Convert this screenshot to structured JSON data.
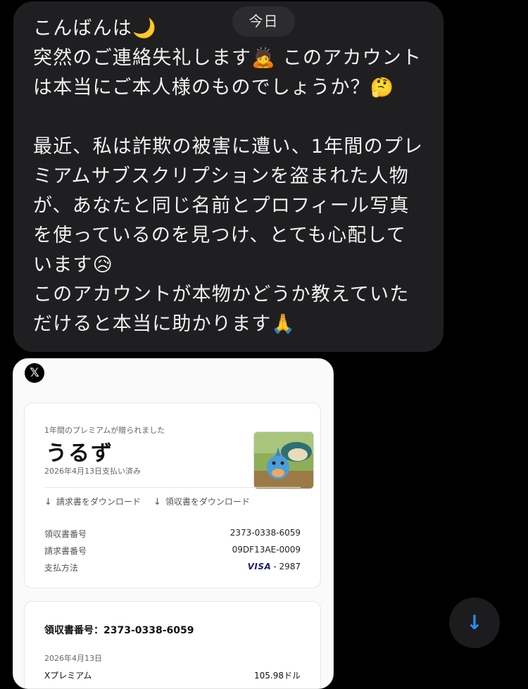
{
  "message": {
    "lines": [
      "こんばんは🌙",
      "突然のご連絡失礼します🙇 このアカウント",
      "は本当にご本人様のものでしょうか？🤔",
      "",
      "最近、私は詐欺の被害に遭い、1年間のプレ",
      "ミアムサブスクリプションを盗まれた人物",
      "が、あなたと同じ名前とプロフィール写真",
      "を使っているのを見つけ、とても心配して",
      "います😥",
      "このアカウントが本物かどうか教えていた",
      "だけると本当に助かります🙏"
    ]
  },
  "date_divider": "今日",
  "attachment": {
    "logo_icon": "x-logo-icon",
    "logo_text": "𝕏",
    "gift_card": {
      "label": "1年間のプレミアムが贈られました",
      "recipient": "うるず",
      "paid_date": "2026年4月13日支払い済み",
      "download_invoice": "請求書をダウンロード",
      "download_receipt": "領収書をダウンロード",
      "rows": [
        {
          "label": "領収書番号",
          "value": "2373-0338-6059"
        },
        {
          "label": "請求書番号",
          "value": "09DF13AE-0009"
        },
        {
          "label": "支払方法",
          "card_brand": "VISA",
          "value": "- 2987"
        }
      ]
    },
    "receipt_card": {
      "heading": "領収書番号：2373-0338-6059",
      "date": "2026年4月13日",
      "item": "Xプレミアム",
      "price": "105.98ドル"
    }
  },
  "scroll_button": {
    "icon": "arrow-down-icon",
    "glyph": "↓",
    "accent": "#2a8cff"
  },
  "colors": {
    "background": "#000000",
    "bubble": "#1f1f21",
    "text": "#f2f2f2"
  }
}
